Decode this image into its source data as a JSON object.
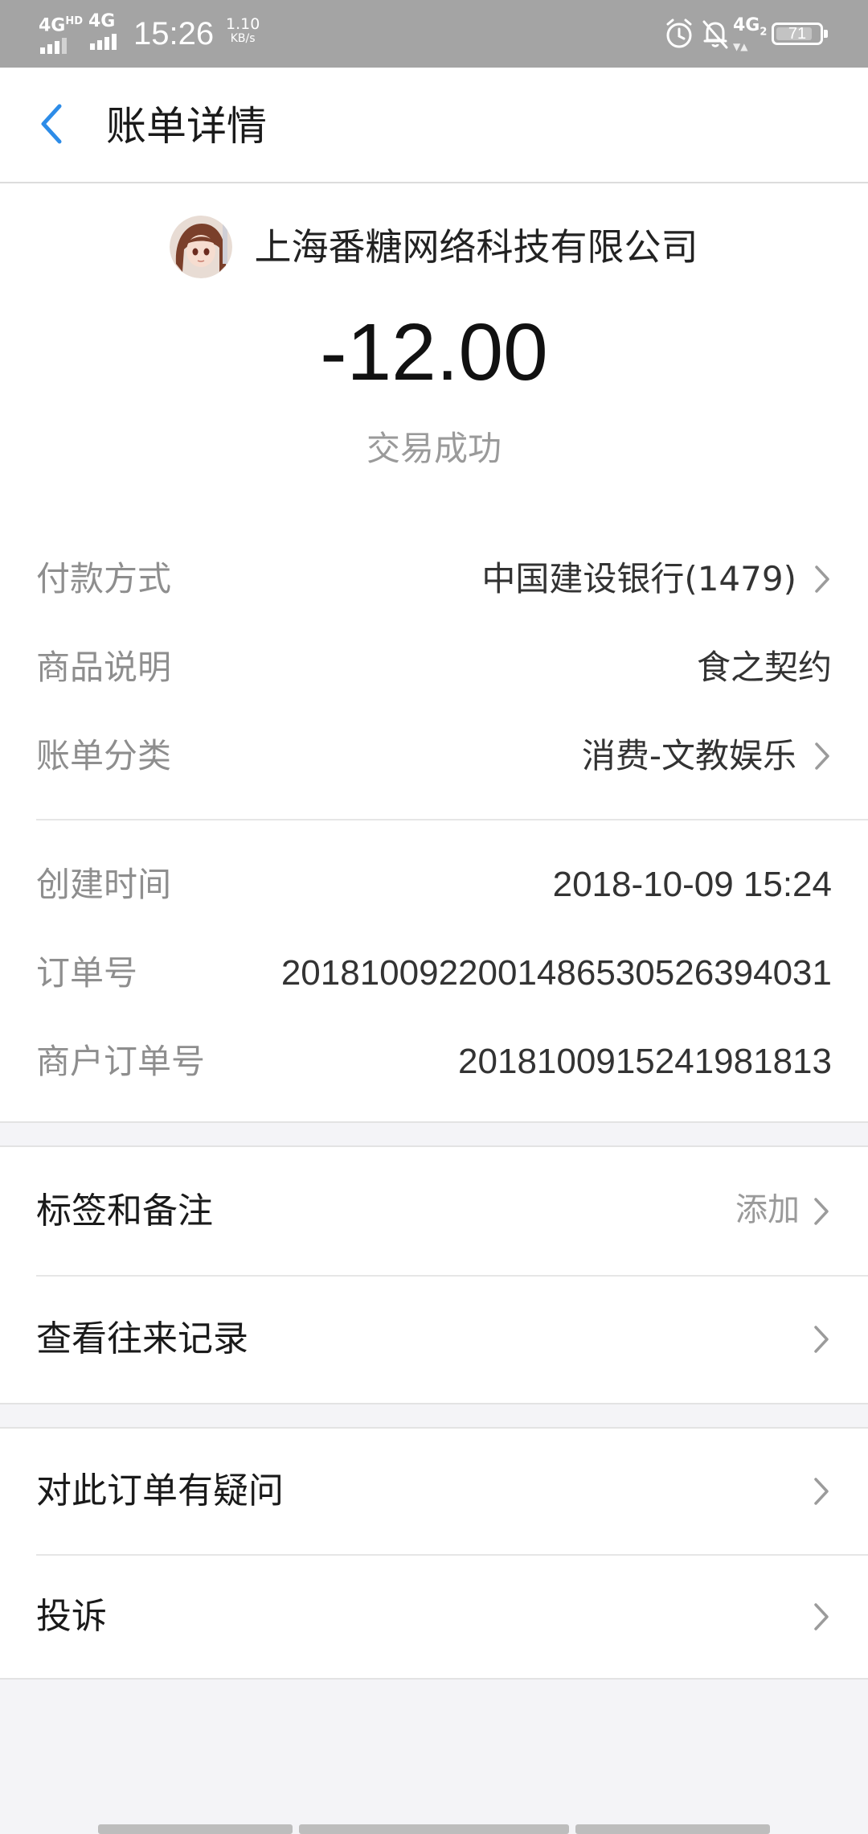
{
  "status_bar": {
    "signal_left": "4G",
    "signal_left_badge": "HD",
    "signal_right": "4G",
    "time": "15:26",
    "speed_value": "1.10",
    "speed_unit": "KB/s",
    "sim2_label": "4G",
    "sim2_badge": "2",
    "battery_level": "71"
  },
  "header": {
    "title": "账单详情"
  },
  "transaction": {
    "merchant": "上海番糖网络科技有限公司",
    "amount": "-12.00",
    "status": "交易成功"
  },
  "details_primary": [
    {
      "label": "付款方式",
      "value": "中国建设银行(1479)"
    },
    {
      "label": "商品说明",
      "value": "食之契约"
    },
    {
      "label": "账单分类",
      "value": "消费-文教娱乐"
    }
  ],
  "details_secondary": [
    {
      "label": "创建时间",
      "value": "2018-10-09 15:24"
    },
    {
      "label": "订单号",
      "value": "20181009220014865305263940​31"
    },
    {
      "label": "商户订单号",
      "value": "2018100915241981813"
    }
  ],
  "actions_group1": [
    {
      "label": "标签和备注",
      "aux": "添加"
    },
    {
      "label": "查看往来记录"
    }
  ],
  "actions_group2": [
    {
      "label": "对此订单有疑问"
    },
    {
      "label": "投诉"
    }
  ],
  "colors": {
    "accent": "#2d8ce8",
    "status_bar": "#a4a4a4",
    "label_gray": "#8e8e8e",
    "background": "#f4f4f7"
  }
}
